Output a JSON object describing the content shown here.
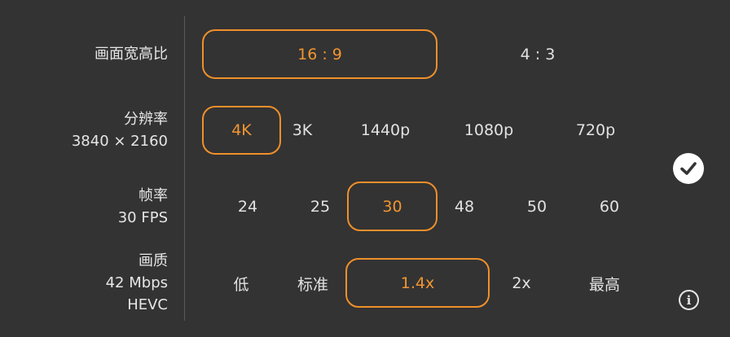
{
  "rows": {
    "aspect": {
      "title": "画面宽高比",
      "options": [
        "16 : 9",
        "4 : 3"
      ],
      "selected": "16 : 9"
    },
    "resolution": {
      "title": "分辨率",
      "subtitle": "3840 × 2160",
      "options": [
        "4K",
        "3K",
        "1440p",
        "1080p",
        "720p"
      ],
      "selected": "4K"
    },
    "framerate": {
      "title": "帧率",
      "subtitle": "30 FPS",
      "options": [
        "24",
        "25",
        "30",
        "48",
        "50",
        "60"
      ],
      "selected": "30"
    },
    "quality": {
      "title": "画质",
      "subtitle": "42 Mbps",
      "subtitle2": "HEVC",
      "options": [
        "低",
        "标准",
        "1.4x",
        "2x",
        "最高"
      ],
      "selected": "1.4x"
    }
  },
  "buttons": {
    "confirm_icon": "checkmark-icon",
    "info_icon": "info-icon",
    "info_glyph": "i"
  },
  "colors": {
    "background": "#333333",
    "accent": "#f0902a",
    "text": "#e6e6e6"
  }
}
